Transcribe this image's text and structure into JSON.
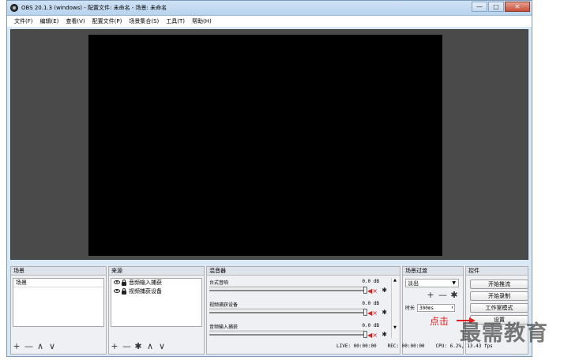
{
  "window": {
    "title": "OBS 20.1.3 (windows) - 配置文件: 未命名 - 场景: 未命名",
    "minimize": "—",
    "maximize": "□",
    "close": "✕"
  },
  "menu": {
    "items": [
      "文件(F)",
      "编辑(E)",
      "查看(V)",
      "配置文件(P)",
      "场景集合(S)",
      "工具(T)",
      "帮助(H)"
    ]
  },
  "scenes": {
    "header": "场景",
    "items": [
      "场景"
    ]
  },
  "sources": {
    "header": "来源",
    "items": [
      "音频输入捕获",
      "视频捕获设备"
    ]
  },
  "mixer": {
    "header": "混音器",
    "channels": [
      {
        "name": "台式音响",
        "db": "0.0 dB"
      },
      {
        "name": "视频捕获设备",
        "db": "0.0 dB"
      },
      {
        "name": "音频输入捕获",
        "db": "0.0 dB"
      }
    ]
  },
  "transitions": {
    "header": "场景过渡",
    "selected": "淡出",
    "duration_label": "时长",
    "duration_value": "300ms"
  },
  "controls": {
    "header": "控件",
    "start_streaming": "开始推流",
    "start_recording": "开始录制",
    "studio_mode": "工作室模式",
    "settings": "设置"
  },
  "status": {
    "live": "LIVE: 00:00:00",
    "rec": "REC: 00:00:00",
    "cpu": "CPU: 6.2%, 13.43 fps"
  },
  "icons": {
    "add": "+",
    "remove": "—",
    "up": "∧",
    "down": "∨",
    "gear": "✱",
    "mute": "◀×"
  },
  "annotation": {
    "text": "点击"
  },
  "watermark": {
    "text": "最需教育"
  },
  "colors": {
    "annotation": "#e02020",
    "mute": "#d42020"
  }
}
